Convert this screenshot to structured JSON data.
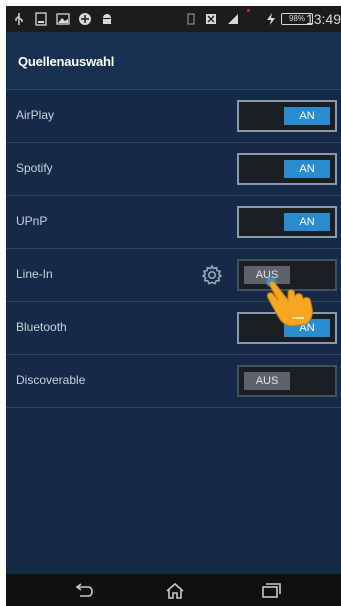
{
  "statusbar": {
    "battery": "98%",
    "time": "13:49",
    "icons": [
      "usb-icon",
      "sd-card-icon",
      "image-icon",
      "vpn-icon",
      "android-icon",
      "vibrate-icon",
      "no-sim-icon",
      "signal-icon",
      "charging-icon",
      "battery-icon"
    ]
  },
  "header": {
    "title": "Quellenauswahl"
  },
  "sources": [
    {
      "label": "AirPlay",
      "state": "AN"
    },
    {
      "label": "Spotify",
      "state": "AN"
    },
    {
      "label": "UPnP",
      "state": "AN"
    },
    {
      "label": "Line-In",
      "state": "AUS",
      "settings_icon": "gear-icon"
    },
    {
      "label": "Bluetooth",
      "state": "AN"
    },
    {
      "label": "Discoverable",
      "state": "AUS"
    }
  ],
  "overlay": {
    "icon": "pointing-hand-icon"
  },
  "navbar": {
    "icons": [
      "back-icon",
      "home-icon",
      "recent-apps-icon"
    ]
  },
  "colors": {
    "background": "#152a47",
    "toggle_on": "#2a8bd0",
    "toggle_off": "#5c636b"
  }
}
